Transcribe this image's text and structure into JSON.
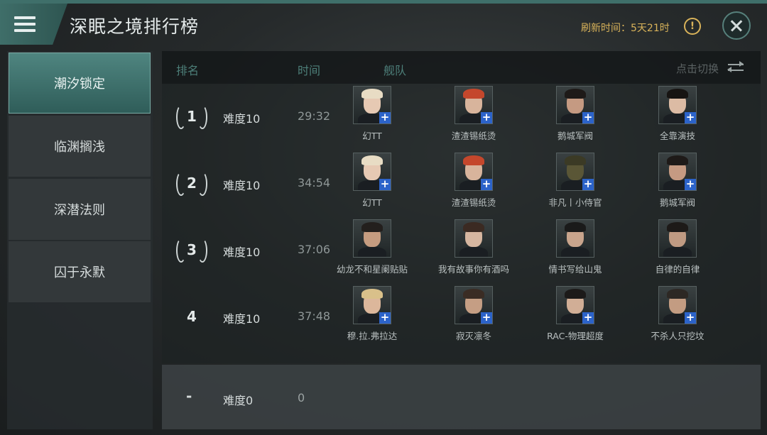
{
  "header": {
    "title": "深眠之境排行榜",
    "refresh_label": "刷新时间：5天21时"
  },
  "sidebar": {
    "items": [
      {
        "label": "潮汐锁定",
        "active": true
      },
      {
        "label": "临渊搁浅",
        "active": false
      },
      {
        "label": "深潜法则",
        "active": false
      },
      {
        "label": "囚于永默",
        "active": false
      }
    ]
  },
  "table": {
    "columns": {
      "rank": "排名",
      "time": "时间",
      "fleet": "舰队"
    },
    "toggle_label": "点击切换",
    "rows": [
      {
        "rank": "1",
        "laurel": true,
        "difficulty": "难度10",
        "time": "29:32",
        "members": [
          {
            "name": "幻TT",
            "plus": true,
            "hair": "#e8dcc4",
            "skin": "#e6c9b3"
          },
          {
            "name": "渣渣锡纸烫",
            "plus": true,
            "hair": "#c4472c",
            "skin": "#d8b49c"
          },
          {
            "name": "鹅城军阀",
            "plus": true,
            "hair": "#1e1a18",
            "skin": "#c59a82"
          },
          {
            "name": "全靠演技",
            "plus": true,
            "hair": "#171412",
            "skin": "#dcbba4"
          }
        ]
      },
      {
        "rank": "2",
        "laurel": true,
        "difficulty": "难度10",
        "time": "34:54",
        "members": [
          {
            "name": "幻TT",
            "plus": true,
            "hair": "#e8dcc4",
            "skin": "#e6c9b3"
          },
          {
            "name": "渣渣锡纸烫",
            "plus": true,
            "hair": "#c4472c",
            "skin": "#d8b49c"
          },
          {
            "name": "非凡丨小侍官",
            "plus": true,
            "hair": "#3b3a25",
            "skin": "#5a5636"
          },
          {
            "name": "鹅城军阀",
            "plus": true,
            "hair": "#1e1a18",
            "skin": "#c59a82"
          }
        ]
      },
      {
        "rank": "3",
        "laurel": true,
        "difficulty": "难度10",
        "time": "37:06",
        "members": [
          {
            "name": "幼龙不和星阑贴贴",
            "plus": false,
            "hair": "#231f1d",
            "skin": "#c59c80"
          },
          {
            "name": "我有故事你有酒吗",
            "plus": false,
            "hair": "#3b2a22",
            "skin": "#d6b6a0"
          },
          {
            "name": "情书写给山鬼",
            "plus": false,
            "hair": "#1a1a1a",
            "skin": "#c8a48c"
          },
          {
            "name": "自律的自律",
            "plus": false,
            "hair": "#1d1a18",
            "skin": "#bf9a82"
          }
        ]
      },
      {
        "rank": "4",
        "laurel": false,
        "difficulty": "难度10",
        "time": "37:48",
        "members": [
          {
            "name": "穆.拉.弗拉达",
            "plus": true,
            "hair": "#d9c08a",
            "skin": "#dcb79b"
          },
          {
            "name": "寂灭凛冬",
            "plus": true,
            "hair": "#3a2c24",
            "skin": "#c59e84"
          },
          {
            "name": "RAC-物理超度",
            "plus": true,
            "hair": "#1c1a19",
            "skin": "#d1ae96"
          },
          {
            "name": "不杀人只挖坟",
            "plus": true,
            "hair": "#2d2824",
            "skin": "#c39c82"
          }
        ]
      }
    ]
  },
  "my_record": {
    "rank": "-",
    "difficulty": "难度0",
    "time": "0"
  },
  "colors": {
    "accent_teal": "#3f6e69",
    "refresh_gold": "#d9b35a",
    "plus_blue": "#2c63c9"
  }
}
